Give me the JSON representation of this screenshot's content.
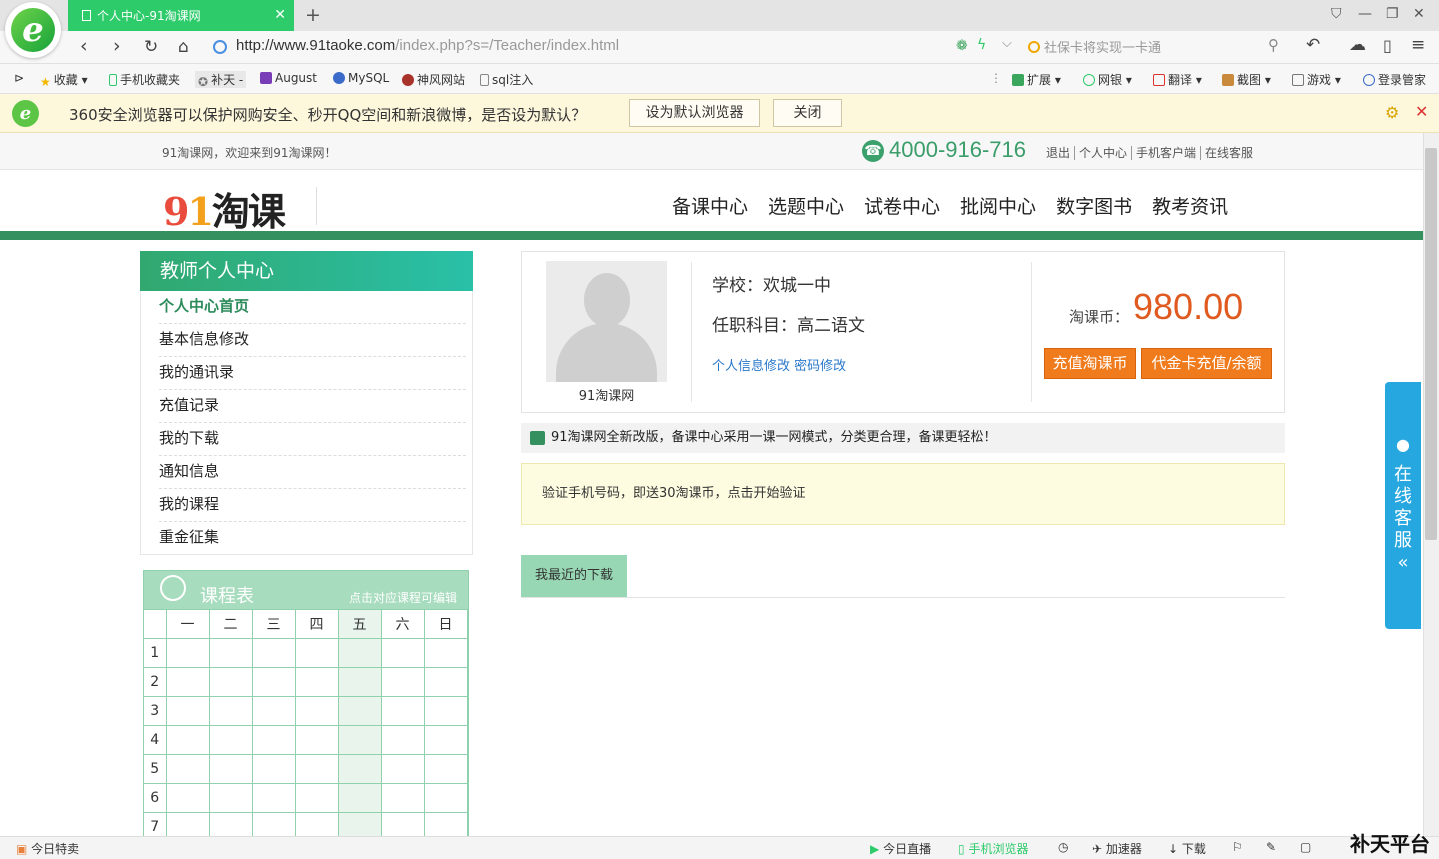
{
  "browser": {
    "tab_title": "个人中心-91淘课网",
    "url_host": "http://www.91taoke.com",
    "url_path": "/index.php?s=/Teacher/index.html",
    "search_placeholder": "社保卡将实现一卡通",
    "bookmarks": [
      "收藏",
      "手机收藏夹",
      "补天 -",
      "August",
      "MySQL",
      "神风网站",
      "sql注入"
    ],
    "right_tools": [
      "扩展",
      "网银",
      "翻译",
      "截图",
      "游戏",
      "登录管家"
    ],
    "notification": {
      "text": "360安全浏览器可以保护网购安全、秒开QQ空间和新浪微博，是否设为默认？",
      "set_default": "设为默认浏览器",
      "close": "关闭"
    },
    "status_bar": {
      "left": "今日特卖",
      "live": "今日直播",
      "mobile": "手机浏览器",
      "accel": "加速器",
      "download": "下载"
    },
    "accent_color": "#2ecb6b"
  },
  "site": {
    "welcome": "91淘课网，欢迎来到91淘课网！",
    "phone": "4000-916-716",
    "top_links": [
      "退出",
      "个人中心",
      "手机客户端",
      "在线客服"
    ],
    "logo_text": "淘课",
    "logo_digits": [
      "9",
      "1"
    ],
    "nav": [
      "备课中心",
      "选题中心",
      "试卷中心",
      "批阅中心",
      "数字图书",
      "教考资讯"
    ],
    "brand_color": "#34905e"
  },
  "sidebar": {
    "title": "教师个人中心",
    "items": [
      "个人中心首页",
      "基本信息修改",
      "我的通讯录",
      "充值记录",
      "我的下载",
      "通知信息",
      "我的课程",
      "重金征集"
    ]
  },
  "schedule": {
    "title": "课程表",
    "hint": "点击对应课程可编辑",
    "days": [
      "一",
      "二",
      "三",
      "四",
      "五",
      "六",
      "日"
    ],
    "periods": [
      "1",
      "2",
      "3",
      "4",
      "5",
      "6",
      "7"
    ]
  },
  "profile": {
    "avatar_name": "91淘课网",
    "school": "学校：欢城一中",
    "subject": "任职科目：高二语文",
    "link_info": "个人信息修改",
    "link_password": "密码修改",
    "coin_label": "淘课币：",
    "coin_value": "980.00",
    "btn_recharge": "充值淘课币",
    "btn_card": "代金卡充值/余额"
  },
  "announcement": "91淘课网全新改版，备课中心采用一课一网模式，分类更合理，备课更轻松！",
  "verify_notice": "验证手机号码，即送30淘课币，点击开始验证",
  "downloads_tab": "我最近的下载",
  "service_float": [
    "在",
    "线",
    "客",
    "服"
  ],
  "watermark": "补天平台"
}
